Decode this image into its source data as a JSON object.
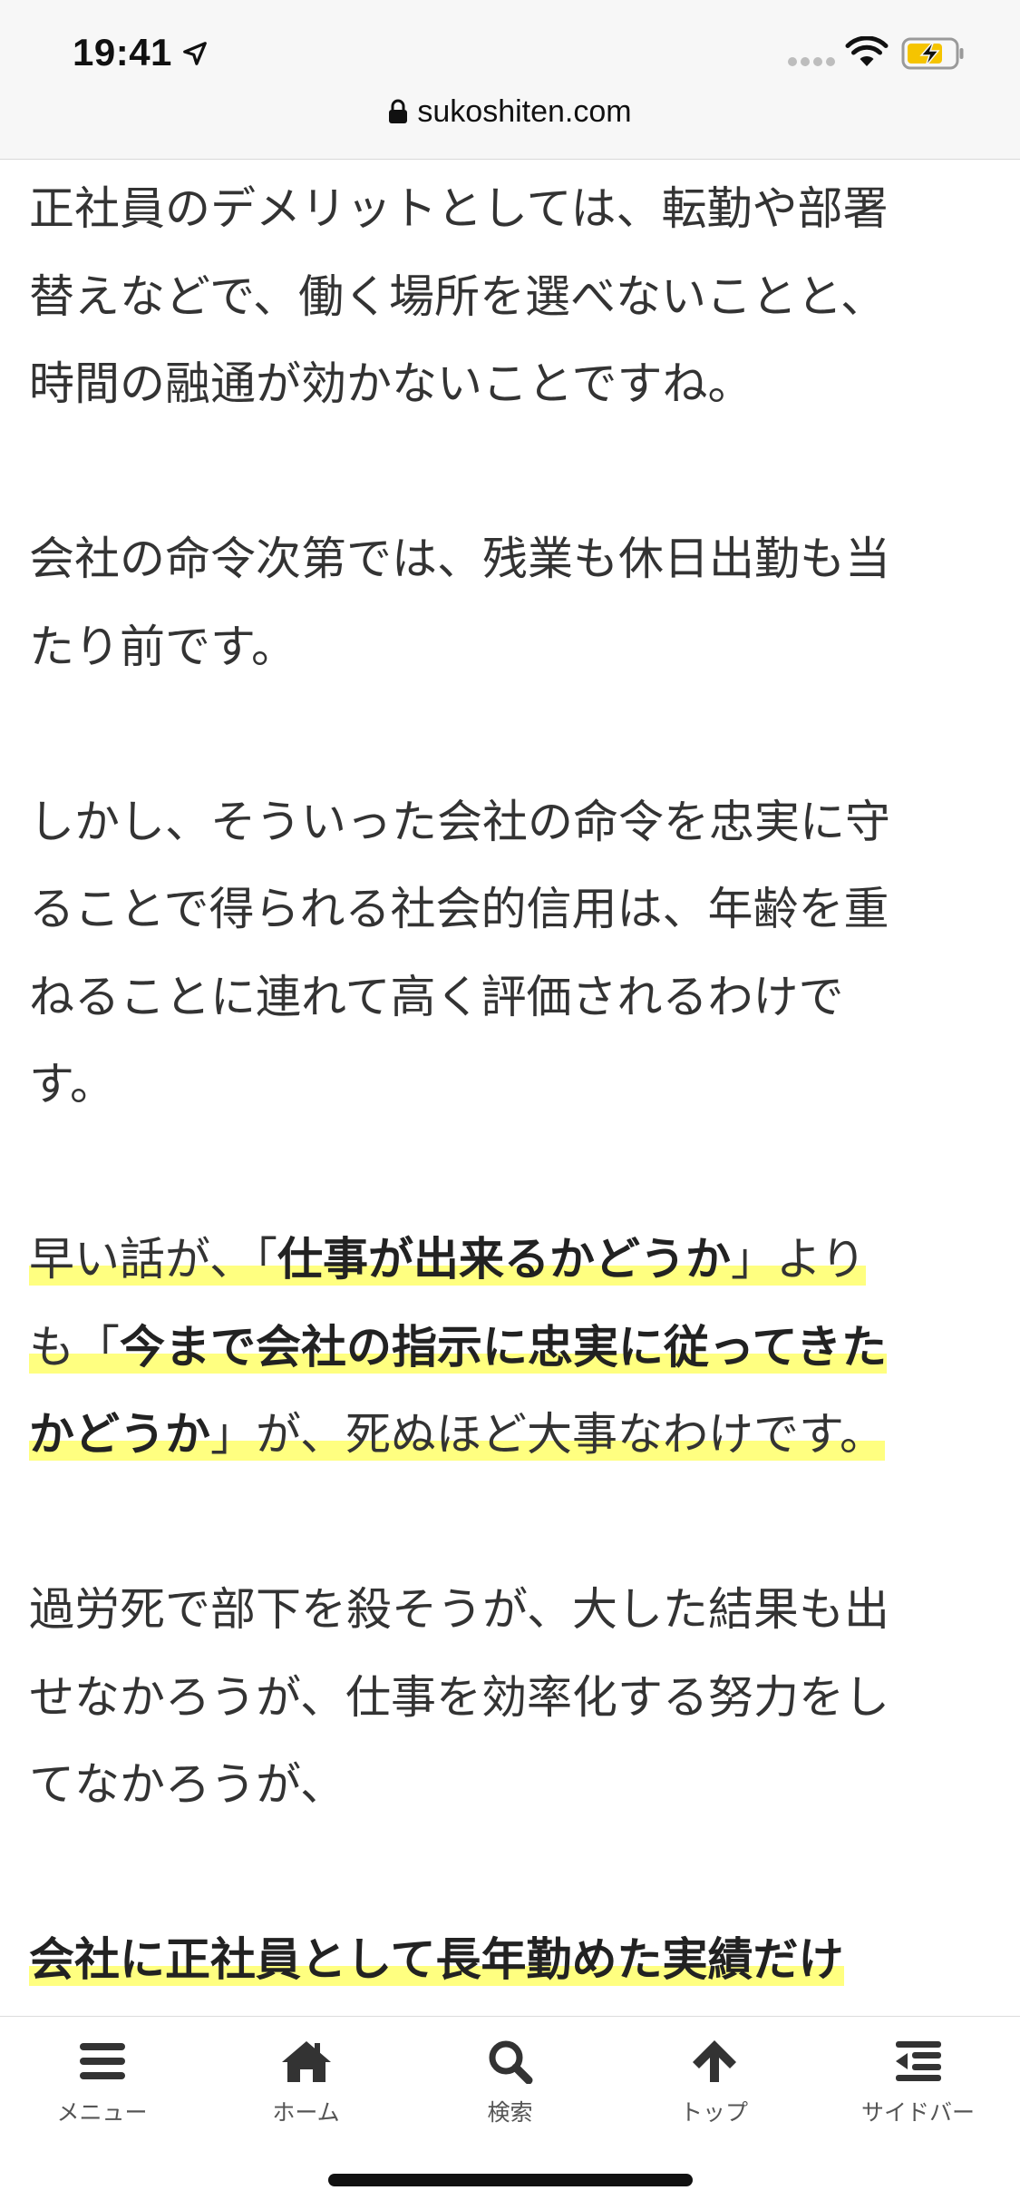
{
  "status_bar": {
    "time": "19:41",
    "icons": [
      "location-arrow-icon",
      "signal-dots-icon",
      "wifi-icon",
      "battery-charging-icon"
    ],
    "battery_color": "#f5c400"
  },
  "url_bar": {
    "domain": "sukoshiten.com",
    "icon": "lock-icon"
  },
  "article": {
    "paragraphs": [
      {
        "lines": [
          "正社員のデメリットとしては、転勤や部署",
          "替えなどで、働く場所を選べないことと、",
          "時間の融通が効かないことですね。"
        ]
      },
      {
        "lines": [
          "会社の命令次第では、残業も休日出勤も当",
          "たり前です。"
        ]
      },
      {
        "lines": [
          "しかし、そういった会社の命令を忠実に守",
          "ることで得られる社会的信用は、年齢を重",
          "ねることに連れて高く評価されるわけで",
          "す。"
        ]
      },
      {
        "highlighted": {
          "p1": "早い話が、",
          "q1_open": "「",
          "b1": "仕事が出来るかどうか",
          "q1_close": "」",
          "p2": "より",
          "p3": "も",
          "q2_open": "「",
          "b2a": "今まで会社の指示に忠実に従ってきた",
          "b2b": "かどうか",
          "q2_close": "」",
          "p4": "が、死ぬほど大事なわけです。"
        }
      },
      {
        "lines": [
          "過労死で部下を殺そうが、大した結果も出",
          "せなかろうが、仕事を効率化する努力をし",
          "てなかろうが、"
        ]
      },
      {
        "bold_line": "会社に正社員として長年勤めた実績だけ"
      }
    ],
    "highlight_color": "#ffff80"
  },
  "bottom_nav": {
    "items": [
      {
        "label": "メニュー",
        "icon": "menu-icon"
      },
      {
        "label": "ホーム",
        "icon": "home-icon"
      },
      {
        "label": "検索",
        "icon": "search-icon"
      },
      {
        "label": "トップ",
        "icon": "arrow-up-icon"
      },
      {
        "label": "サイドバー",
        "icon": "sidebar-icon"
      }
    ]
  }
}
